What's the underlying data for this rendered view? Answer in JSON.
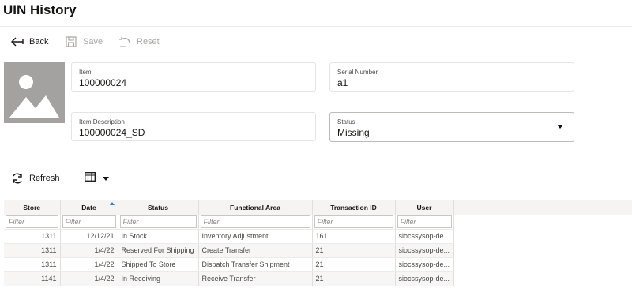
{
  "page": {
    "title": "UIN History"
  },
  "toolbar": {
    "back_label": "Back",
    "save_label": "Save",
    "reset_label": "Reset"
  },
  "details": {
    "item": {
      "label": "Item",
      "value": "100000024"
    },
    "serial": {
      "label": "Serial Number",
      "value": "a1"
    },
    "description": {
      "label": "Item Description",
      "value": "100000024_SD"
    },
    "status": {
      "label": "Status",
      "value": "Missing"
    }
  },
  "actions": {
    "refresh_label": "Refresh"
  },
  "table": {
    "columns": [
      "Store",
      "Date",
      "Status",
      "Functional Area",
      "Transaction ID",
      "User"
    ],
    "filter_placeholder": "Filter",
    "rows": [
      [
        "1311",
        "12/12/21",
        "In Stock",
        "Inventory Adjustment",
        "161",
        "siocssysop-de..."
      ],
      [
        "1311",
        "1/4/22",
        "Reserved For Shipping",
        "Create Transfer",
        "21",
        "siocssysop-de..."
      ],
      [
        "1311",
        "1/4/22",
        "Shipped To Store",
        "Dispatch Transfer Shipment",
        "21",
        "siocssysop-de..."
      ],
      [
        "1141",
        "1/4/22",
        "In Receiving",
        "Receive Transfer",
        "21",
        "siocssysop-de..."
      ]
    ]
  }
}
